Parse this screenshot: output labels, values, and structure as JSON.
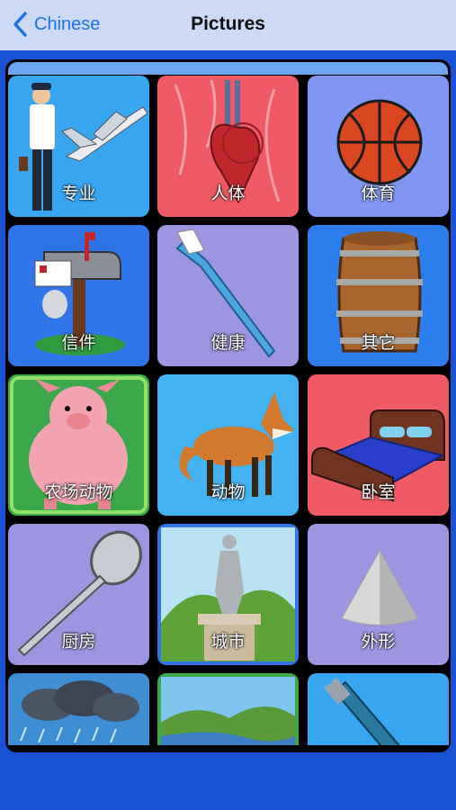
{
  "nav": {
    "back_label": "Chinese",
    "title": "Pictures"
  },
  "tiles": [
    {
      "label": "专业",
      "icon": "pilot-airplane-icon",
      "bg": "#39a6f2"
    },
    {
      "label": "人体",
      "icon": "heart-anatomy-icon",
      "bg": "#ef5a64"
    },
    {
      "label": "体育",
      "icon": "basketball-icon",
      "bg": "#7f96f2"
    },
    {
      "label": "信件",
      "icon": "mailbox-icon",
      "bg": "#2f74e8"
    },
    {
      "label": "健康",
      "icon": "toothbrush-icon",
      "bg": "#9c95e0"
    },
    {
      "label": "其它",
      "icon": "barrel-icon",
      "bg": "#2e7ded"
    },
    {
      "label": "农场动物",
      "icon": "pig-icon",
      "bg": "#3da84a"
    },
    {
      "label": "动物",
      "icon": "fox-icon",
      "bg": "#44b3f2"
    },
    {
      "label": "卧室",
      "icon": "bed-icon",
      "bg": "#ef5a64"
    },
    {
      "label": "厨房",
      "icon": "spoon-icon",
      "bg": "#9c95e0"
    },
    {
      "label": "城市",
      "icon": "statue-icon",
      "bg": "#2f74e8"
    },
    {
      "label": "外形",
      "icon": "cone-icon",
      "bg": "#9c95e0"
    },
    {
      "label": "",
      "icon": "rain-cloud-icon",
      "bg": "#3f8ed4"
    },
    {
      "label": "",
      "icon": "landscape-icon",
      "bg": "#3da84a"
    },
    {
      "label": "",
      "icon": "pen-icon",
      "bg": "#39a6f2"
    }
  ]
}
